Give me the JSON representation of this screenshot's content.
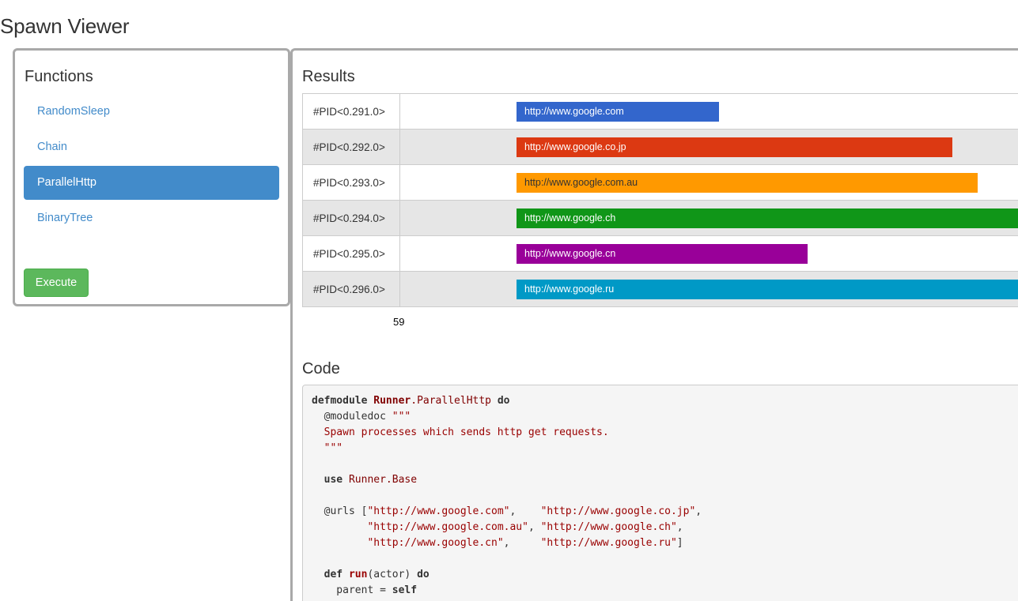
{
  "app": {
    "title": "Spawn Viewer"
  },
  "functions": {
    "heading": "Functions",
    "items": [
      {
        "label": "RandomSleep",
        "active": false
      },
      {
        "label": "Chain",
        "active": false
      },
      {
        "label": "ParallelHttp",
        "active": true
      },
      {
        "label": "BinaryTree",
        "active": false
      }
    ],
    "execute_label": "Execute"
  },
  "results": {
    "heading": "Results",
    "axis_label": "59",
    "rows": [
      {
        "pid": "#PID<0.291.0>",
        "url": "http://www.google.com",
        "color": "#3366cc"
      },
      {
        "pid": "#PID<0.292.0>",
        "url": "http://www.google.co.jp",
        "color": "#dc3912"
      },
      {
        "pid": "#PID<0.293.0>",
        "url": "http://www.google.com.au",
        "color": "#ff9900"
      },
      {
        "pid": "#PID<0.294.0>",
        "url": "http://www.google.ch",
        "color": "#109618"
      },
      {
        "pid": "#PID<0.295.0>",
        "url": "http://www.google.cn",
        "color": "#990099"
      },
      {
        "pid": "#PID<0.296.0>",
        "url": "http://www.google.ru",
        "color": "#0099c6"
      }
    ]
  },
  "code": {
    "heading": "Code",
    "lines": [
      "defmodule Runner.ParallelHttp do",
      "  @moduledoc \"\"\"",
      "  Spawn processes which sends http get requests.",
      "  \"\"\"",
      "",
      "  use Runner.Base",
      "",
      "  @urls [\"http://www.google.com\",    \"http://www.google.co.jp\",",
      "         \"http://www.google.com.au\", \"http://www.google.ch\",",
      "         \"http://www.google.cn\",     \"http://www.google.ru\"]",
      "",
      "  def run(actor) do",
      "    parent = self"
    ]
  }
}
